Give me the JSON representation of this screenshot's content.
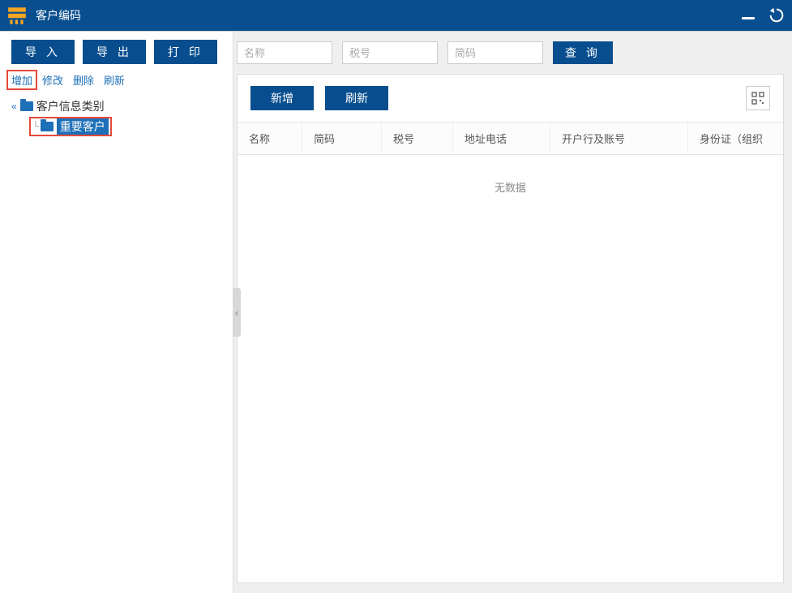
{
  "colors": {
    "primary": "#084e8e",
    "highlight_border": "#e54a3a",
    "link": "#1d6fb8"
  },
  "titlebar": {
    "title": "客户编码"
  },
  "sidebar": {
    "buttons": {
      "import": "导 入",
      "export": "导 出",
      "print": "打 印"
    },
    "links": {
      "add": "增加",
      "edit": "修改",
      "delete": "删除",
      "refresh": "刷新"
    },
    "tree": {
      "root": "客户信息类别",
      "child": "重要客户"
    }
  },
  "search": {
    "name_placeholder": "名称",
    "taxno_placeholder": "税号",
    "shortcode_placeholder": "简码",
    "query_label": "查 询"
  },
  "content": {
    "add_label": "新增",
    "refresh_label": "刷新",
    "columns": {
      "name": "名称",
      "shortcode": "简码",
      "taxno": "税号",
      "addrphone": "地址电话",
      "bank": "开户行及账号",
      "idorg": "身份证（组织"
    },
    "no_data": "无数据",
    "rows": []
  }
}
